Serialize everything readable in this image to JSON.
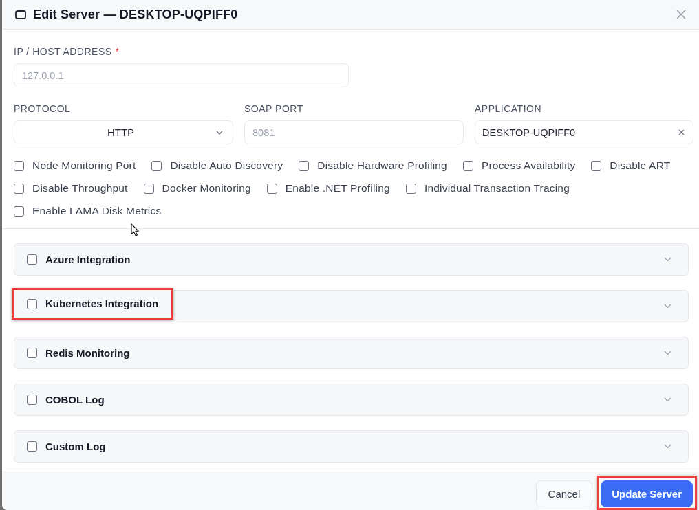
{
  "dialog": {
    "title": "Edit Server — DESKTOP-UQPIFF0"
  },
  "host_address": {
    "label": "IP / HOST ADDRESS",
    "required_mark": "*",
    "placeholder": "127.0.0.1"
  },
  "protocol": {
    "label": "PROTOCOL",
    "value": "HTTP"
  },
  "soap_port": {
    "label": "SOAP PORT",
    "placeholder": "8081"
  },
  "application": {
    "label": "APPLICATION",
    "value": "DESKTOP-UQPIFF0"
  },
  "options": [
    {
      "label": "Node Monitoring Port",
      "checked": false
    },
    {
      "label": "Disable Auto Discovery",
      "checked": false
    },
    {
      "label": "Disable Hardware Profiling",
      "checked": false
    },
    {
      "label": "Process Availability",
      "checked": false
    },
    {
      "label": "Disable ART",
      "checked": false
    },
    {
      "label": "Disable Throughput",
      "checked": false
    },
    {
      "label": "Docker Monitoring",
      "checked": false
    },
    {
      "label": "Enable .NET Profiling",
      "checked": false
    },
    {
      "label": "Individual Transaction Tracing",
      "checked": false
    },
    {
      "label": "Enable LAMA Disk Metrics",
      "checked": false
    }
  ],
  "integrations": [
    {
      "label": "Azure Integration",
      "checked": false,
      "expanded": false,
      "highlighted": false
    },
    {
      "label": "Kubernetes Integration",
      "checked": false,
      "expanded": false,
      "highlighted": true
    },
    {
      "label": "Redis Monitoring",
      "checked": false,
      "expanded": false,
      "highlighted": false
    },
    {
      "label": "COBOL Log",
      "checked": false,
      "expanded": false,
      "highlighted": false
    },
    {
      "label": "Custom Log",
      "checked": false,
      "expanded": false,
      "highlighted": false
    }
  ],
  "buttons": [
    {
      "label": "Cancel",
      "kind": "secondary",
      "highlighted": false
    },
    {
      "label": "Update Server",
      "kind": "primary",
      "highlighted": true
    }
  ]
}
